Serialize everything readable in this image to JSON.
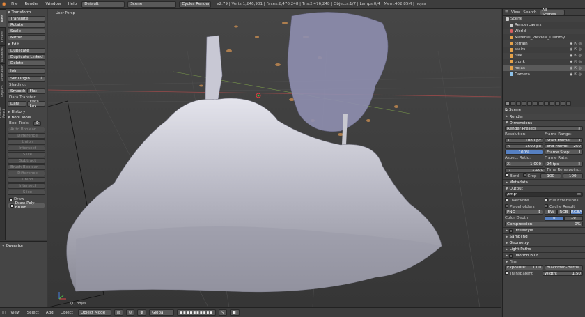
{
  "topbar": {
    "menus": [
      "File",
      "Render",
      "Window",
      "Help"
    ],
    "layout": "Default",
    "scene": "Scene",
    "engine": "Cycles Render",
    "stats": "v2.79 | Verts:1,246,901 | Faces:2,476,248 | Tris:2,476,248 | Objects:1/7 | Lamps:0/4 | Mem:402.85M | hojas"
  },
  "tooltabs": [
    "Tools",
    "Create",
    "Relations",
    "Animation",
    "Physics",
    "Grease Pencil"
  ],
  "tools": {
    "transform_header": "Transform",
    "transform": [
      "Translate",
      "Rotate",
      "Scale",
      "Mirror"
    ],
    "edit_header": "Edit",
    "edit": [
      "Duplicate",
      "Duplicate Linked",
      "Delete"
    ],
    "join": "Join",
    "set_origin": "Set Origin",
    "shading_label": "Shading:",
    "smooth": "Smooth",
    "flat": "Flat",
    "data_transfer_label": "Data Transfer:",
    "data": "Data",
    "data_lay": "Data Lay",
    "history": "History",
    "bool_tools_header": "Bool Tools",
    "bool_tools_label": "Bool Tools:",
    "auto_boolean": "Auto Boolean",
    "auto_list": [
      "Difference",
      "Union",
      "Intersect",
      "Slice",
      "Subtract"
    ],
    "brush_boolean": "Brush Boolean",
    "brush_list": [
      "Difference",
      "Union",
      "Intersect",
      "Slice"
    ],
    "draw": "Draw",
    "draw_poly": "Draw Poly Brush"
  },
  "operator": {
    "header": "Operator"
  },
  "viewport": {
    "label": "User Persp",
    "object_label": "(1) hojas"
  },
  "bottombar": {
    "items": [
      "View",
      "Select",
      "Add",
      "Object"
    ],
    "mode": "Object Mode",
    "orientation": "Global"
  },
  "outliner": {
    "menus": [
      "View",
      "Search"
    ],
    "filter": "All Scenes",
    "rows": [
      {
        "name": "Scene",
        "color": "#c9c9c9"
      },
      {
        "name": "RenderLayers",
        "color": "#c9c9c9"
      },
      {
        "name": "World",
        "color": "#d95f5f"
      },
      {
        "name": "Material_Preview_Dummy",
        "color": "#e5a24a"
      },
      {
        "name": "terrain",
        "color": "#e5a24a"
      },
      {
        "name": "stairs",
        "color": "#e5a24a"
      },
      {
        "name": "tree",
        "color": "#e5a24a"
      },
      {
        "name": "trunk",
        "color": "#e5a24a"
      },
      {
        "name": "hojas",
        "color": "#e5a24a"
      },
      {
        "name": "Camera",
        "color": "#8ec1e8"
      }
    ]
  },
  "props": {
    "scene": "Scene",
    "render": "Render",
    "dimensions": "Dimensions",
    "render_presets": "Render Presets",
    "resolution": "Resolution:",
    "res_x_label": "X:",
    "res_x": "1080 px",
    "res_y_label": "Y:",
    "res_y": "1500 px",
    "res_pct": "100%",
    "frame_range": "Frame Range:",
    "start_label": "Start Frame:",
    "start": "1",
    "end_label": "End Frame:",
    "end": "250",
    "step_label": "Frame Step:",
    "step": "1",
    "aspect": "Aspect Ratio:",
    "asp_x_label": "X:",
    "asp_x": "1.000",
    "asp_y_label": "Y:",
    "asp_y": "1.000",
    "frame_rate": "Frame Rate:",
    "fps": "24 fps",
    "time_remap": "Time Remapping:",
    "remap_old": "100",
    "remap_new": "100",
    "border": "Bord",
    "crop": "Crop",
    "metadata": "Metadata",
    "output": "Output",
    "output_path": "/tmp\\",
    "overwrite": "Overwrite",
    "file_ext": "File Extensions",
    "placeholders": "Placeholders",
    "cache": "Cache Result",
    "format": "PNG",
    "bw": "BW",
    "rgb": "RGB",
    "rgba": "RGBA",
    "color_depth": "Color Depth:",
    "depth8": "8",
    "depth16": "16",
    "compression_label": "Compression:",
    "compression": "0%",
    "freestyle": "Freestyle",
    "sampling": "Sampling",
    "geometry": "Geometry",
    "light_paths": "Light Paths",
    "motion_blur": "Motion Blur",
    "film": "Film",
    "exposure_label": "Exposure:",
    "exposure": "1.00",
    "filter": "Blackman-Harris",
    "transparent": "Transparent",
    "width_label": "Width:",
    "width": "1.50"
  },
  "colors": {
    "accent": "#5680c2",
    "selection": "#f0a050",
    "mesh": "#b4b4c0"
  }
}
